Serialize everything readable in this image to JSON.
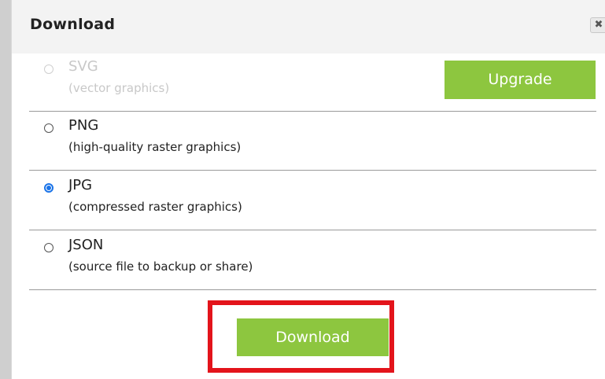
{
  "dialog": {
    "title": "Download",
    "close_glyph": "✖",
    "close_icon": "close-icon"
  },
  "options": [
    {
      "name": "SVG",
      "desc": "(vector graphics)",
      "disabled": true,
      "checked": false
    },
    {
      "name": "PNG",
      "desc": "(high-quality raster graphics)",
      "disabled": false,
      "checked": false
    },
    {
      "name": "JPG",
      "desc": "(compressed raster graphics)",
      "disabled": false,
      "checked": true
    },
    {
      "name": "JSON",
      "desc": "(source file to backup or share)",
      "disabled": false,
      "checked": false
    }
  ],
  "upgrade_label": "Upgrade",
  "download_label": "Download",
  "colors": {
    "accent_green": "#8dc63f",
    "radio_blue": "#1a73e8",
    "highlight_red": "#e3141b"
  }
}
